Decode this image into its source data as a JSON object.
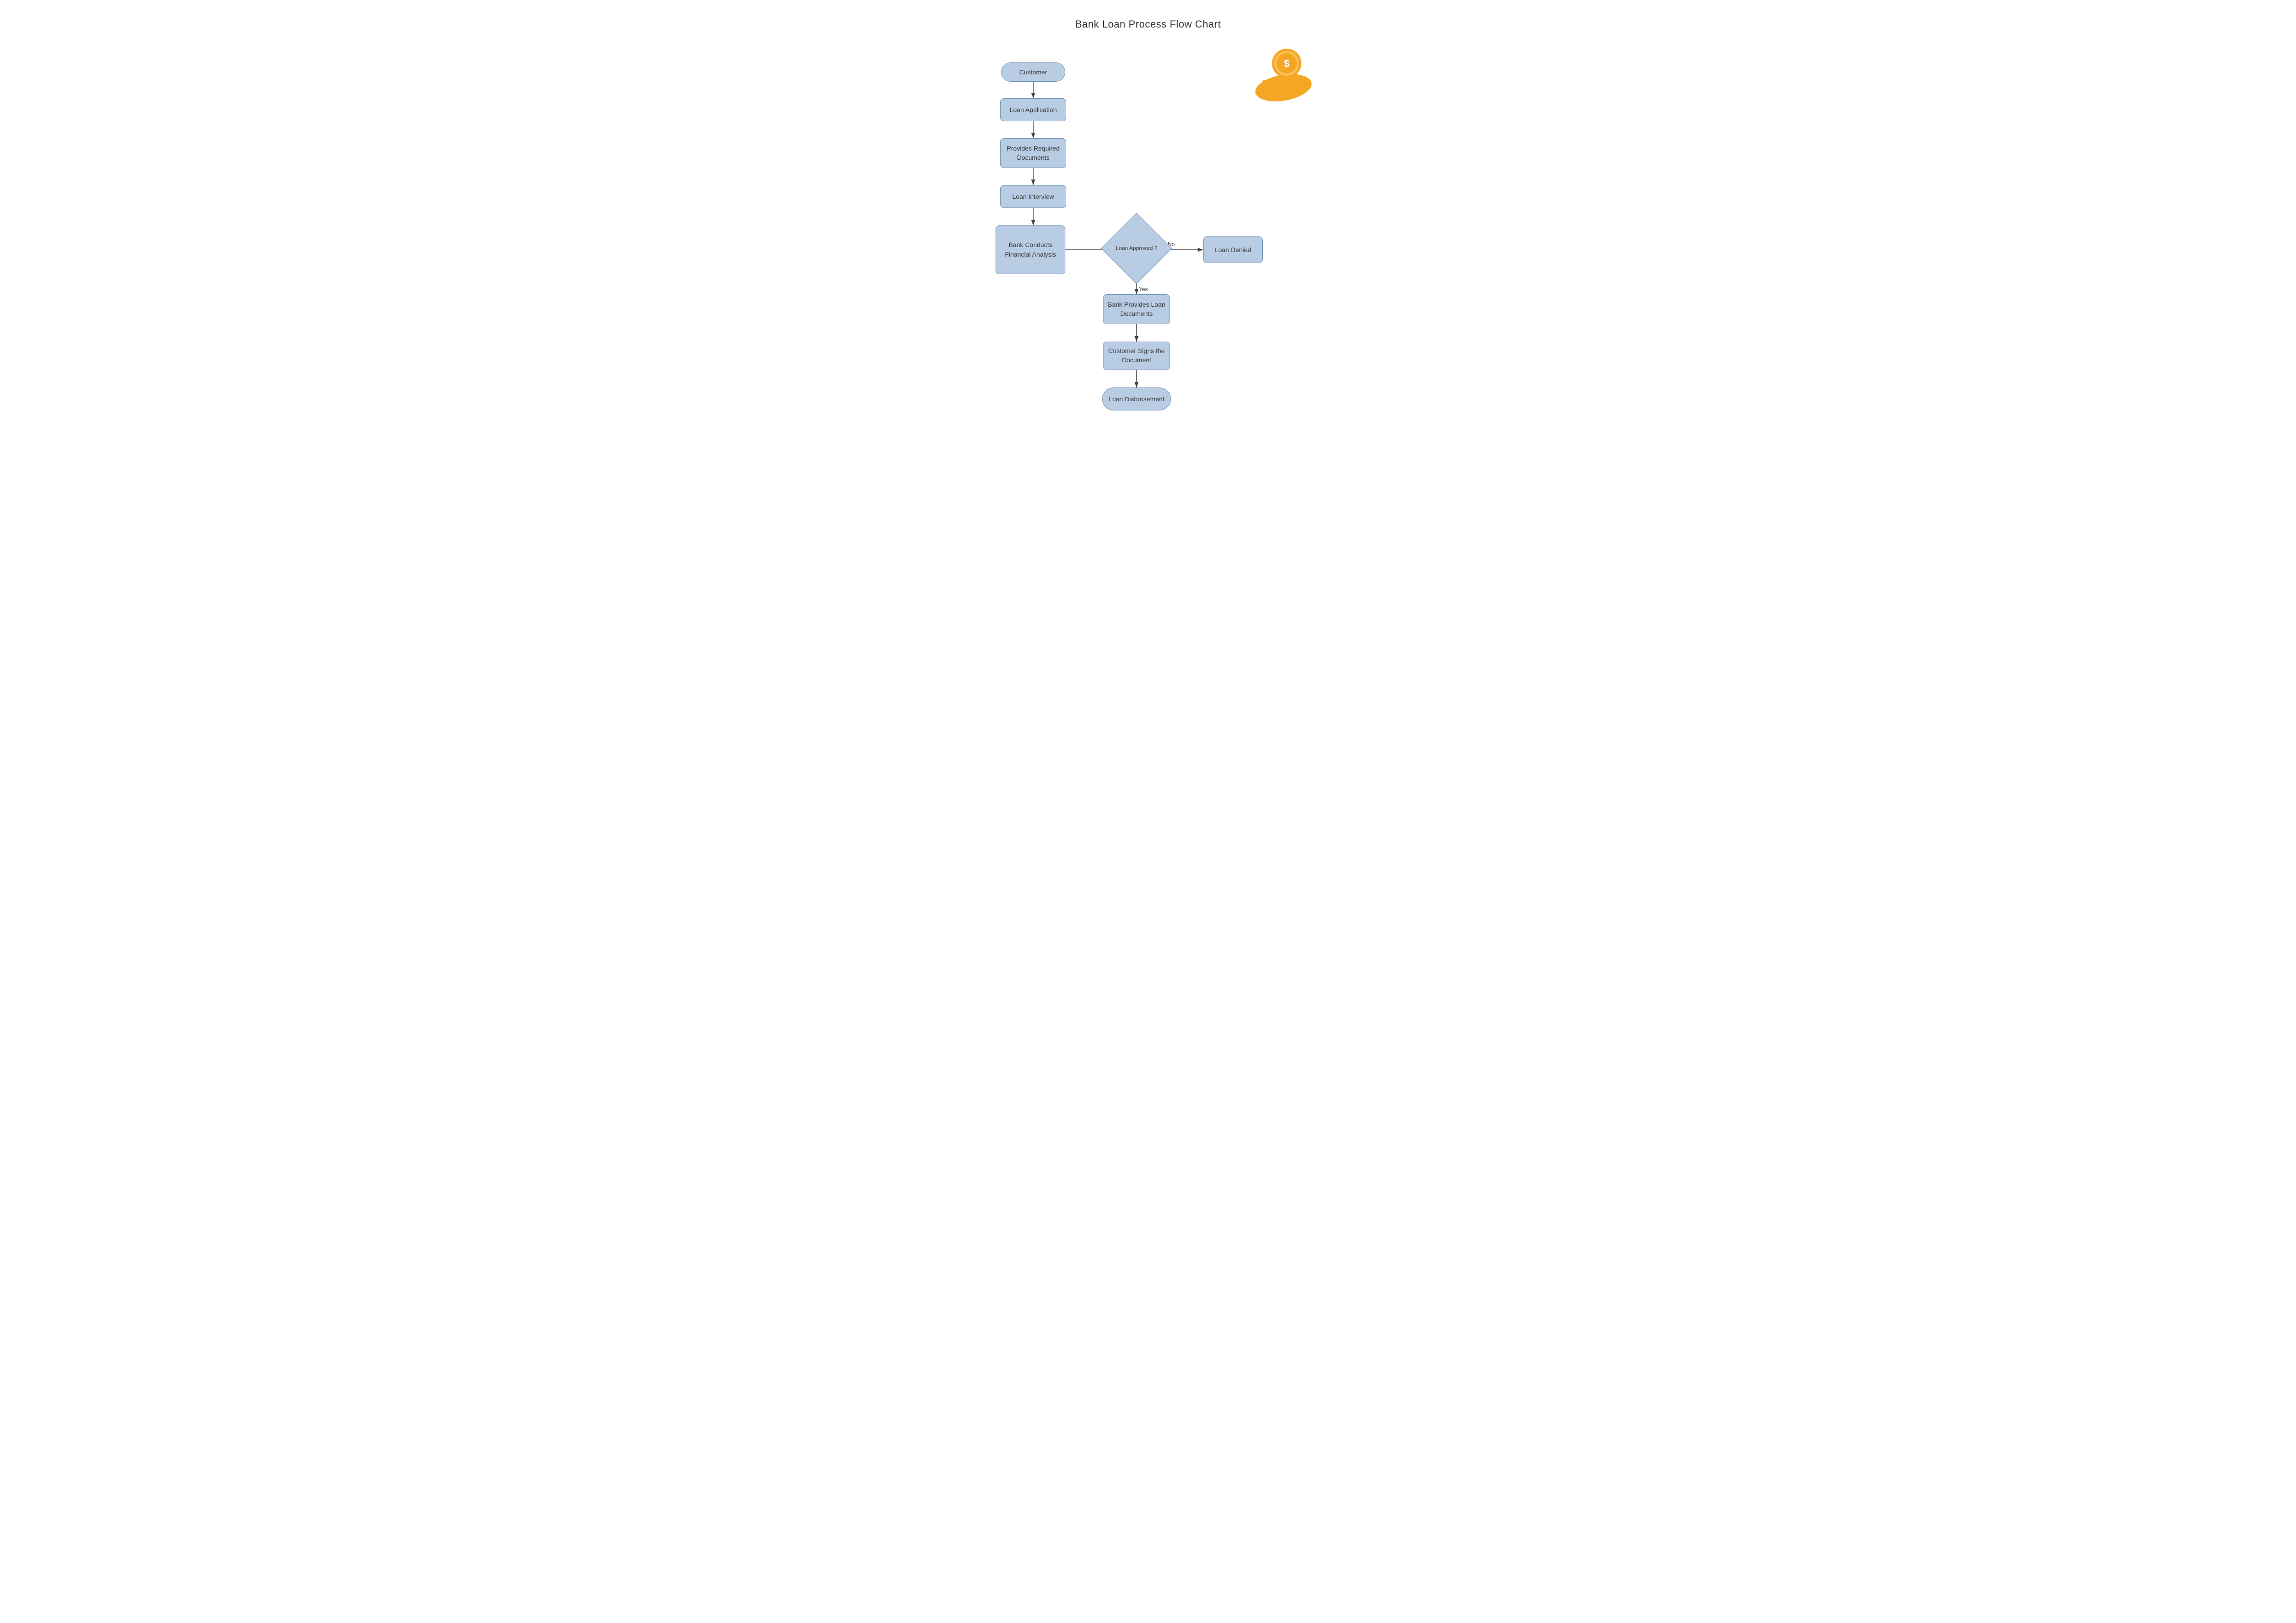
{
  "page": {
    "title": "Bank Loan Process Flow Chart"
  },
  "nodes": {
    "customer": {
      "label": "Customer"
    },
    "loan_application": {
      "label": "Loan Application"
    },
    "provides_documents": {
      "label": "Provides Required Documents"
    },
    "loan_interview": {
      "label": "Loan Interview"
    },
    "bank_analysis": {
      "label": "Bank Conducts Financial Analysis"
    },
    "loan_approved": {
      "label": "Loan Approved ?"
    },
    "loan_denied": {
      "label": "Loan Denied"
    },
    "bank_provides_docs": {
      "label": "Bank Provides Loan Documents"
    },
    "customer_signs": {
      "label": "Customer Signs the Document"
    },
    "loan_disbursement": {
      "label": "Loan Disbursement"
    }
  },
  "labels": {
    "yes": "Yes",
    "no": "No"
  },
  "colors": {
    "node_fill": "#b8cce4",
    "node_border": "#7094b5",
    "arrow": "#444444",
    "title": "#333333",
    "icon_orange": "#F5A623",
    "icon_coin": "#F5A623"
  }
}
